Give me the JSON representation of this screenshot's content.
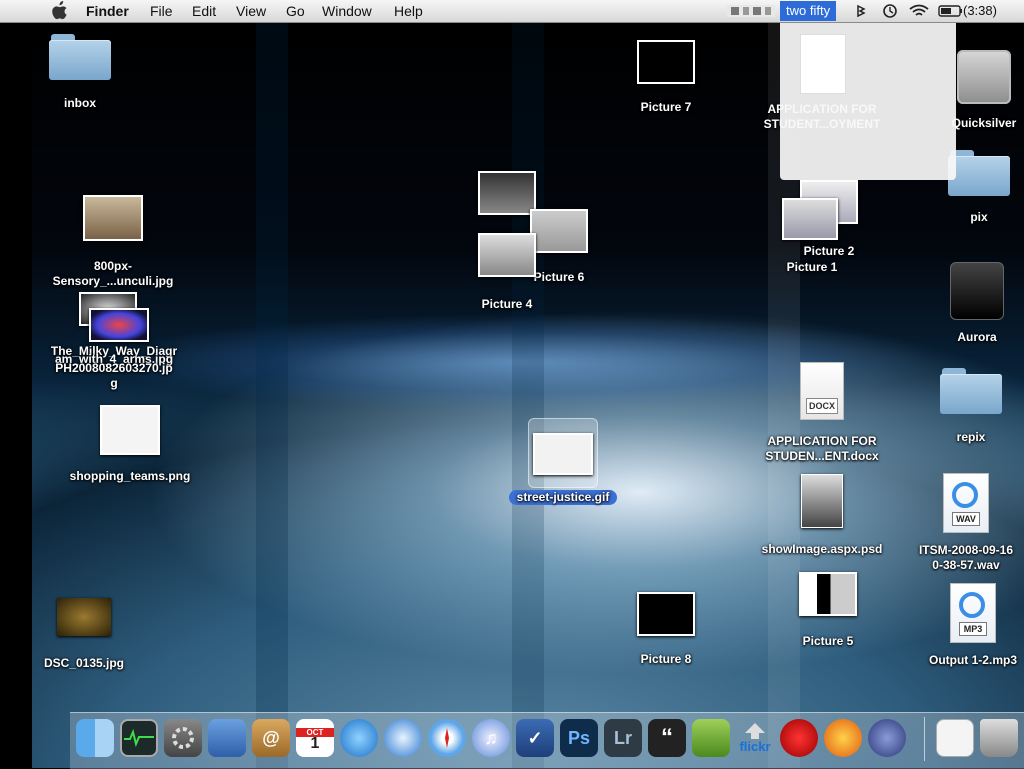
{
  "menubar": {
    "app_name": "Finder",
    "menus": [
      "File",
      "Edit",
      "View",
      "Go",
      "Window",
      "Help"
    ],
    "status_item": "two fifty",
    "clock": "(3:38)"
  },
  "popup": {
    "title_line1": "APPLICATION FOR",
    "title_line2": "STUDENT...OYMENT"
  },
  "desktop_icons": {
    "inbox": "inbox",
    "sensory_line1": "800px-",
    "sensory_line2": "Sensory_...unculi.jpg",
    "milky_line1": "The_Milky_Way_Diagr",
    "milky_line2": "am_with_4_arms.jpg",
    "ph_line1": "PH2008082603270.jp",
    "ph_line2": "g",
    "shopping": "shopping_teams.png",
    "dsc": "DSC_0135.jpg",
    "picture7": "Picture 7",
    "picture6": "Picture 6",
    "picture4": "Picture 4",
    "picture2": "Picture 2",
    "picture1": "Picture 1",
    "street": "street-justice.gif",
    "app_docx_line1": "APPLICATION FOR",
    "app_docx_line2": "STUDEN...ENT.docx",
    "docx_badge": "DOCX",
    "showimage": "showImage.aspx.psd",
    "picture5": "Picture 5",
    "picture8": "Picture 8",
    "quicksilver": "Quicksilver",
    "pix": "pix",
    "aurora": "Aurora",
    "repix": "repix",
    "itsm_line1": "ITSM-2008-09-16",
    "itsm_line2": "0-38-57.wav",
    "wav_badge": "WAV",
    "output": "Output 1-2.mp3",
    "mp3_badge": "MP3"
  },
  "dock": {
    "ps_label": "Ps",
    "lr_label": "Lr",
    "flickr_label": "flickr",
    "calendar_month": "OCT",
    "calendar_day": "1"
  },
  "colors": {
    "selection": "#3b6fd4",
    "menubar_highlight": "#2d6cd8"
  }
}
